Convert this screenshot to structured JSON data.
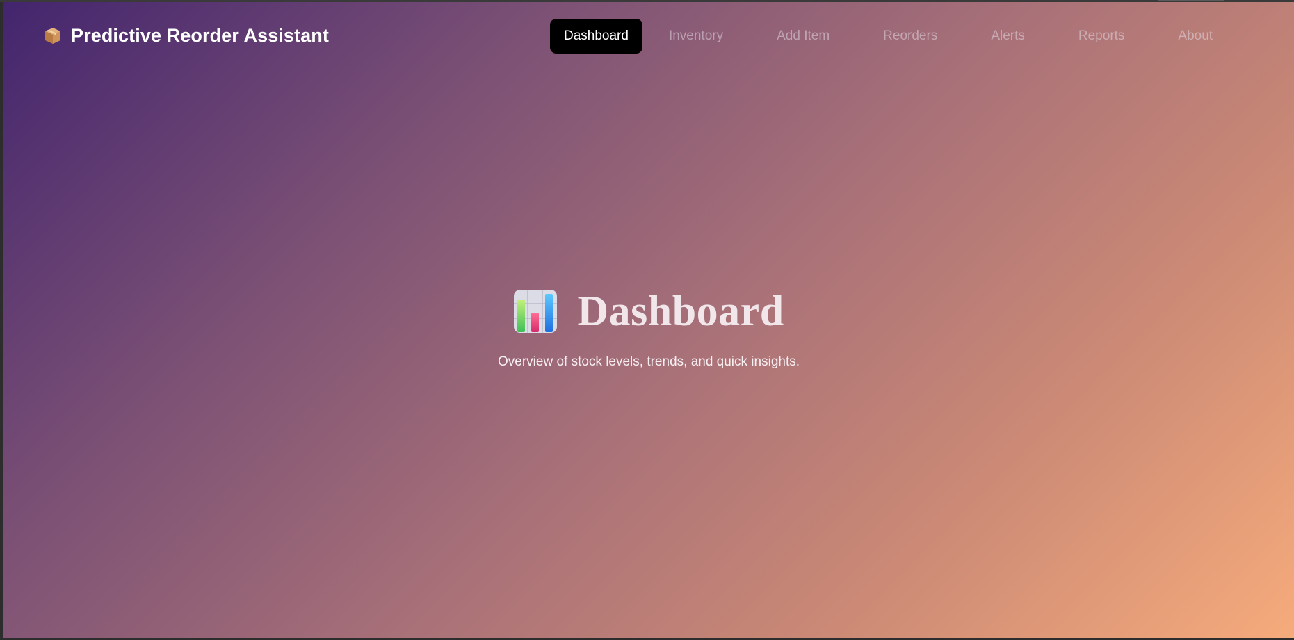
{
  "app": {
    "title": "Predictive Reorder Assistant",
    "brand_icon": "package-icon"
  },
  "nav": {
    "items": [
      {
        "label": "Dashboard",
        "active": true
      },
      {
        "label": "Inventory",
        "active": false
      },
      {
        "label": "Add Item",
        "active": false
      },
      {
        "label": "Reorders",
        "active": false
      },
      {
        "label": "Alerts",
        "active": false
      },
      {
        "label": "Reports",
        "active": false
      },
      {
        "label": "About",
        "active": false
      }
    ]
  },
  "hero": {
    "icon": "bar-chart-icon",
    "title": "Dashboard",
    "subtitle": "Overview of stock levels, trends, and quick insights."
  },
  "colors": {
    "gradient_start": "#43256e",
    "gradient_end": "#f6ab7b",
    "active_nav_bg": "#000000"
  }
}
